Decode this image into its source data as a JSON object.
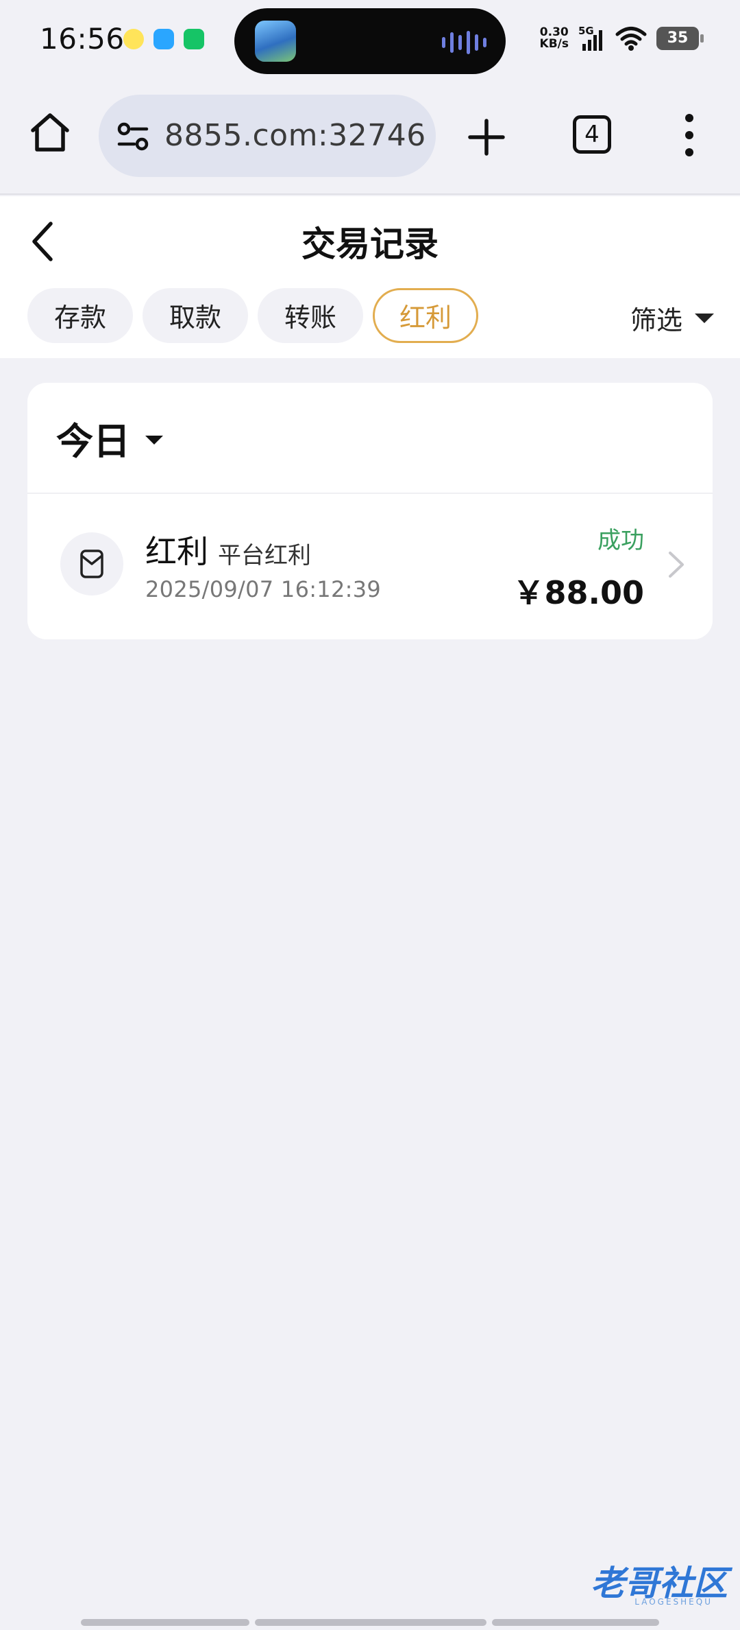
{
  "status_bar": {
    "time": "16:56",
    "net_speed_value": "0.30",
    "net_speed_unit": "KB/s",
    "network": "5G",
    "battery": "35"
  },
  "browser": {
    "url": "8855.com:32746",
    "tab_count": "4"
  },
  "page": {
    "title": "交易记录",
    "tabs": [
      {
        "label": "存款",
        "active": false
      },
      {
        "label": "取款",
        "active": false
      },
      {
        "label": "转账",
        "active": false
      },
      {
        "label": "红利",
        "active": true
      }
    ],
    "filter_label": "筛选"
  },
  "records": {
    "date_group": "今日",
    "items": [
      {
        "type": "红利",
        "subtitle": "平台红利",
        "time": "2025/09/07 16:12:39",
        "status": "成功",
        "amount": "￥88.00"
      }
    ]
  },
  "watermark": {
    "text": "老哥社区",
    "sub": "LAOGESHEQU"
  },
  "colors": {
    "active_tab": "#d69a38",
    "success": "#3aa05f",
    "background": "#f1f1f6"
  }
}
